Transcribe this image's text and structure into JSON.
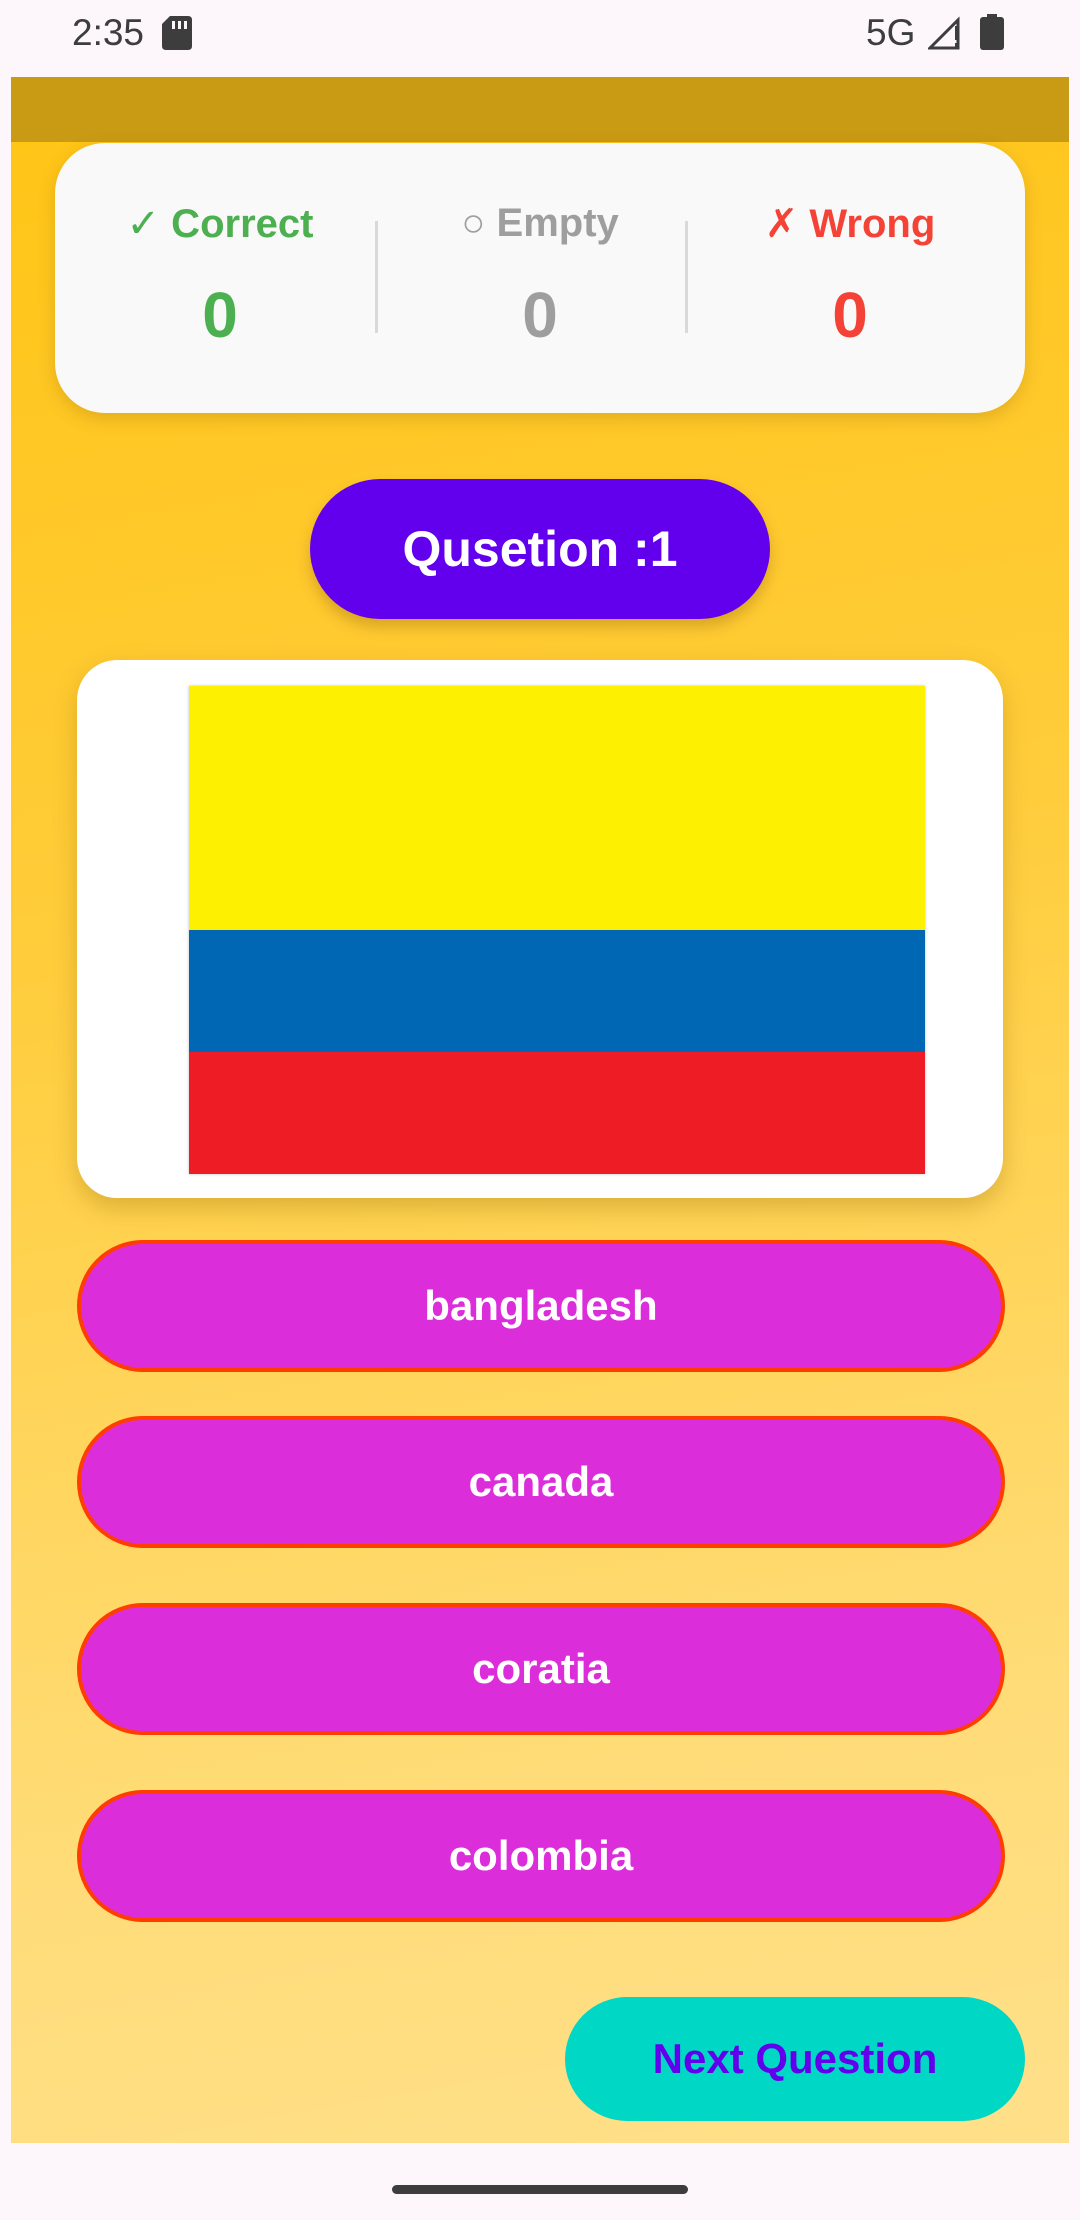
{
  "status_bar": {
    "time": "2:35",
    "network": "5G",
    "icons": [
      "sd-card-icon",
      "signal-icon",
      "battery-icon"
    ]
  },
  "score": {
    "correct": {
      "label": "✓ Correct",
      "value": "0",
      "color": "#4caf50"
    },
    "empty": {
      "label": "○ Empty",
      "value": "0",
      "color": "#9e9e9e"
    },
    "wrong": {
      "label": "✗ Wrong",
      "value": "0",
      "color": "#f44336"
    }
  },
  "question": {
    "label": "Qusetion :1"
  },
  "flag": {
    "icon": "colombia-flag-icon",
    "stripe_colors": [
      "#fdf000",
      "#0067b5",
      "#ee1c25"
    ]
  },
  "answers": [
    {
      "label": "bangladesh"
    },
    {
      "label": "canada"
    },
    {
      "label": "coratia"
    },
    {
      "label": "colombia"
    }
  ],
  "next_button": {
    "label": "Next Question"
  },
  "colors": {
    "accent": "#6200ee",
    "answer_bg": "#dc2ddb",
    "answer_border": "#ff3d00",
    "next_bg": "#00d7c4",
    "app_bar": "#c99a14"
  }
}
